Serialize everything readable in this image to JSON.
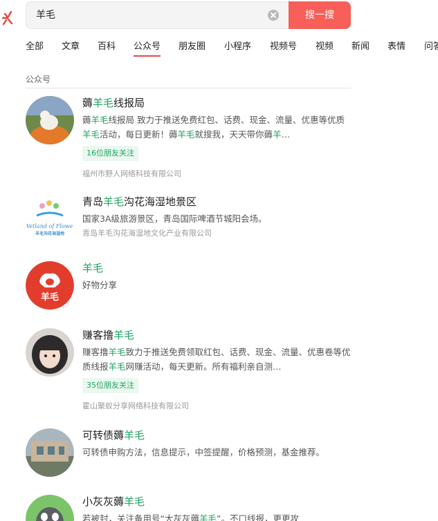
{
  "search": {
    "query": "羊毛",
    "button_label": "搜一搜"
  },
  "tabs": [
    "全部",
    "文章",
    "百科",
    "公众号",
    "朋友圈",
    "小程序",
    "视频号",
    "视频",
    "新闻",
    "表情",
    "问答"
  ],
  "active_tab": "公众号",
  "section_title": "公众号",
  "accounts": [
    {
      "title_parts": [
        "薅",
        "羊毛",
        "线报局"
      ],
      "desc_parts": [
        "薅",
        "羊毛",
        "线报局 致力于推送免费红包、话费、现金、流量、优惠等优质",
        "羊毛",
        "活动，每日更新！薅",
        "羊毛",
        "就搜我，天天带你薅",
        "羊",
        "…"
      ],
      "friends": "16位朋友关注",
      "company": "福州市野人网络科技有限公司"
    },
    {
      "title_parts": [
        "青岛",
        "羊毛",
        "沟花海湿地景区"
      ],
      "desc_parts": [
        "国家3A级旅游景区，青岛国际啤酒节城阳会场。"
      ],
      "company": "青岛羊毛沟花海湿地文化产业有限公司",
      "logo_text": "Wetland of Flower",
      "logo_cn": "羊毛沟花海湿地"
    },
    {
      "title_parts": [
        "",
        "羊毛",
        ""
      ],
      "desc_parts": [
        "好物分享"
      ],
      "logo_text": "羊毛"
    },
    {
      "title_parts": [
        "赚客撸",
        "羊毛",
        ""
      ],
      "desc_parts": [
        "赚客撸",
        "羊毛",
        "致力于推送免费领取红包、话费、现金、流量、优惠卷等优质线报",
        "羊毛",
        "网赚活动，每天更新。所有福利亲自测…"
      ],
      "friends": "35位朋友关注",
      "company": "霍山聚蚁分享网络科技有限公司"
    },
    {
      "title_parts": [
        "可转债薅",
        "羊毛",
        ""
      ],
      "desc_parts": [
        "可转债申购方法，信息提示，中签提醒，价格预测，基金推荐。"
      ]
    },
    {
      "title_parts": [
        "小灰灰薅",
        "羊毛",
        ""
      ],
      "desc_parts": [
        "若被封，关注备用号“大灰灰薅",
        "羊毛",
        "”。不口线报，更更攻"
      ]
    }
  ],
  "colors": {
    "accent": "#f75f58",
    "highlight": "#1da462",
    "tab_underline": "#e24b45"
  }
}
